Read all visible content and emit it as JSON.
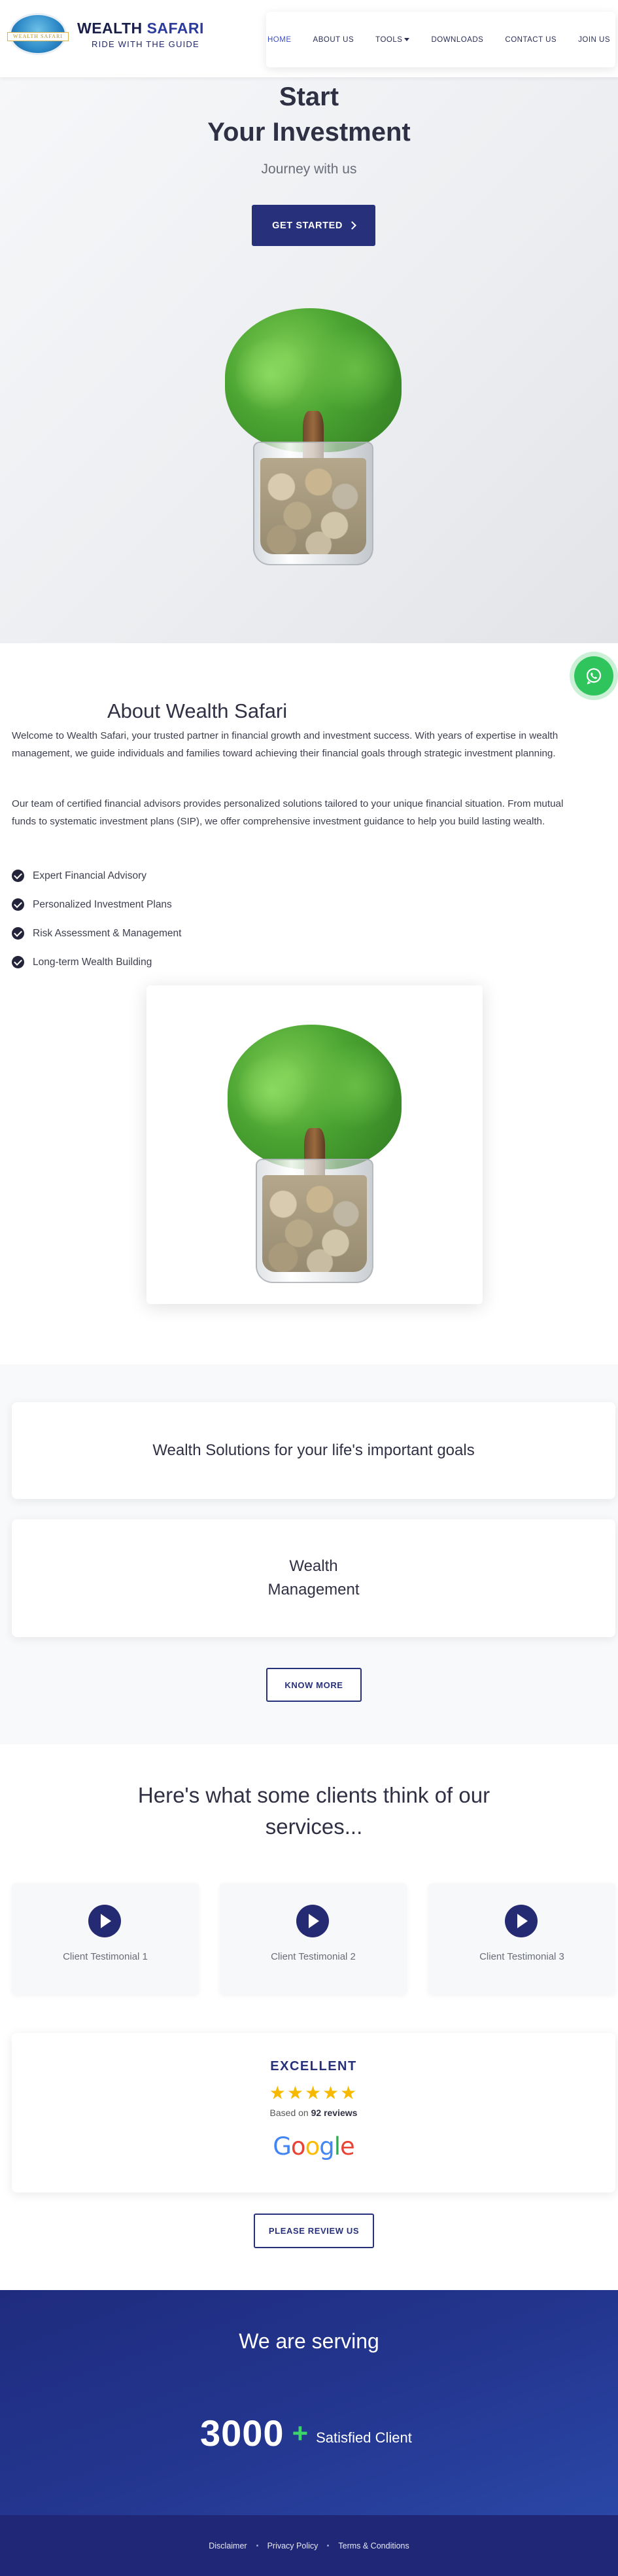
{
  "brand": {
    "name_part1": "WEALTH",
    "name_part2": "SAFARI",
    "tagline": "RIDE WITH THE GUIDE",
    "badge_text": "WEALTH SAFARI"
  },
  "nav": {
    "items": [
      {
        "label": "HOME",
        "active": true
      },
      {
        "label": "ABOUT US"
      },
      {
        "label": "TOOLS",
        "dropdown": true
      },
      {
        "label": "DOWNLOADS"
      },
      {
        "label": "CONTACT US"
      },
      {
        "label": "JOIN US"
      }
    ]
  },
  "hero": {
    "title_line1": "Start",
    "title_line2": "Your Investment",
    "subtitle": "Journey with us",
    "cta_label": "GET STARTED"
  },
  "about": {
    "heading": "About Wealth Safari",
    "paragraph1": "Welcome to Wealth Safari, your trusted partner in financial growth and investment success. With years of expertise in wealth management, we guide individuals and families toward achieving their financial goals through strategic investment planning.",
    "paragraph2": "Our team of certified financial advisors provides personalized solutions tailored to your unique financial situation. From mutual funds to systematic investment plans (SIP), we offer comprehensive investment guidance to help you build lasting wealth.",
    "features": [
      "Expert Financial Advisory",
      "Personalized Investment Plans",
      "Risk Assessment & Management",
      "Long-term Wealth Building"
    ]
  },
  "solutions": {
    "card1": "Wealth Solutions for your life's important goals",
    "card2_line1": "Wealth",
    "card2_line2": "Management",
    "button_label": "KNOW MORE"
  },
  "testimonials": {
    "heading": "Here's what some clients think of our services...",
    "videos": [
      "Client Testimonial 1",
      "Client Testimonial 2",
      "Client Testimonial 3"
    ]
  },
  "reviews": {
    "rating_label": "EXCELLENT",
    "stars": 5,
    "stars_text": "★★★★★",
    "based_on_prefix": "Based on",
    "review_count": "92 reviews",
    "provider": "Google",
    "button_label": "PLEASE REVIEW US"
  },
  "serving": {
    "heading": "We are serving",
    "count": "3000",
    "plus": "+",
    "label": "Satisfied Client"
  },
  "footer": {
    "links": [
      "Disclaimer",
      "Privacy Policy",
      "Terms & Conditions"
    ]
  },
  "colors": {
    "brand_navy": "#27307b",
    "brand_blue": "#2b3c9c",
    "whatsapp_green": "#2fc55c",
    "star_yellow": "#f6b900",
    "footer_bg": "#1f2776"
  }
}
